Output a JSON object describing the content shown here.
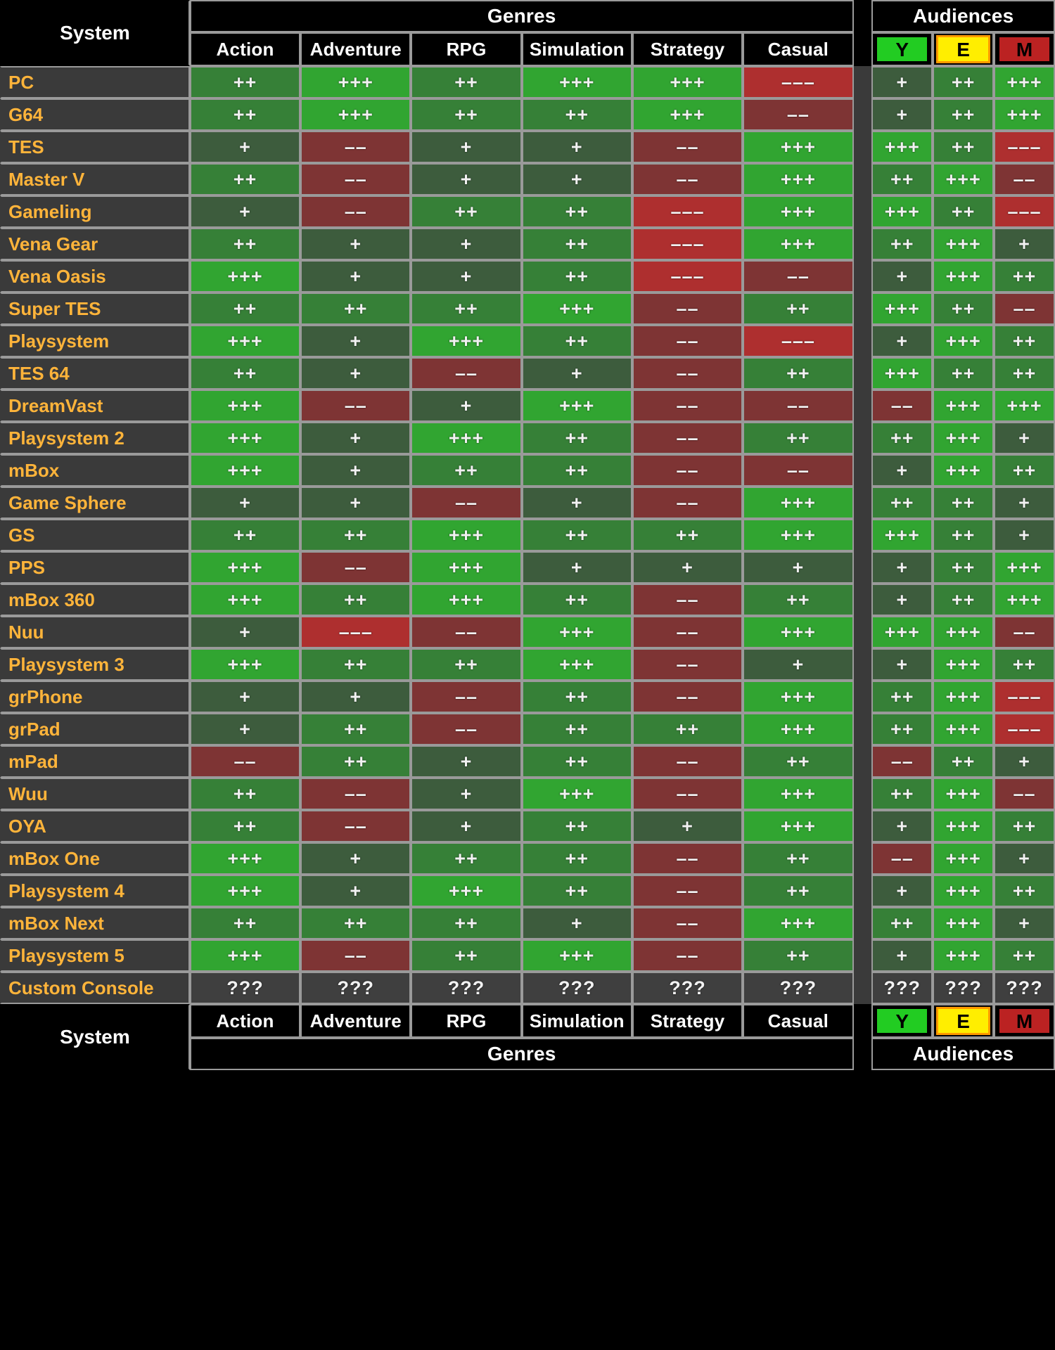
{
  "header": {
    "system_label": "System",
    "genres_group": "Genres",
    "audiences_group": "Audiences",
    "genre_columns": [
      "Action",
      "Adventure",
      "RPG",
      "Simulation",
      "Strategy",
      "Casual"
    ],
    "audience_columns": [
      "Y",
      "E",
      "M"
    ]
  },
  "footer": {
    "system_label": "System",
    "genres_group": "Genres",
    "audiences_group": "Audiences",
    "genre_columns": [
      "Action",
      "Adventure",
      "RPG",
      "Simulation",
      "Strategy",
      "Casual"
    ],
    "audience_columns": [
      "Y",
      "E",
      "M"
    ]
  },
  "colors": {
    "page_background": "#000000",
    "grid_line": "#9a9a9a",
    "system_cell_background": "#3a3a3a",
    "system_name_text": "#ffb43a",
    "rating_text": "#f2f2f2",
    "plus1": "#3d5c3d",
    "plus2": "#368037",
    "plus3": "#31a531",
    "minus1": "#7a3838",
    "minus2": "#7e3434",
    "minus3": "#ae2f2f",
    "unknown": "#3f3f3f",
    "badge_y_background": "#22cc22",
    "badge_e_background": "#ffee00",
    "badge_e_border": "#ff9900",
    "badge_m_background": "#bb2222"
  },
  "legend": {
    "plus_three": "+++",
    "plus_two": "++",
    "plus_one": "+",
    "minus_one": "–",
    "minus_two": "––",
    "minus_three": "–––",
    "unknown": "???"
  },
  "chart_data": {
    "type": "heatmap",
    "title": "",
    "xlabel": "",
    "ylabel": "System",
    "row_key": "System",
    "column_groups": [
      {
        "name": "Genres",
        "columns": [
          "Action",
          "Adventure",
          "RPG",
          "Simulation",
          "Strategy",
          "Casual"
        ]
      },
      {
        "name": "Audiences",
        "columns": [
          "Y",
          "E",
          "M"
        ]
      }
    ],
    "value_scale": [
      "---",
      "--",
      "-",
      "+",
      "++",
      "+++",
      "???"
    ],
    "rows": [
      {
        "name": "PC",
        "genres": [
          "++",
          "+++",
          "++",
          "+++",
          "+++",
          "---"
        ],
        "audiences": [
          "+",
          "++",
          "+++"
        ]
      },
      {
        "name": "G64",
        "genres": [
          "++",
          "+++",
          "++",
          "++",
          "+++",
          "--"
        ],
        "audiences": [
          "+",
          "++",
          "+++"
        ]
      },
      {
        "name": "TES",
        "genres": [
          "+",
          "--",
          "+",
          "+",
          "--",
          "+++"
        ],
        "audiences": [
          "+++",
          "++",
          "---"
        ]
      },
      {
        "name": "Master V",
        "genres": [
          "++",
          "--",
          "+",
          "+",
          "--",
          "+++"
        ],
        "audiences": [
          "++",
          "+++",
          "--"
        ]
      },
      {
        "name": "Gameling",
        "genres": [
          "+",
          "--",
          "++",
          "++",
          "---",
          "+++"
        ],
        "audiences": [
          "+++",
          "++",
          "---"
        ]
      },
      {
        "name": "Vena Gear",
        "genres": [
          "++",
          "+",
          "+",
          "++",
          "---",
          "+++"
        ],
        "audiences": [
          "++",
          "+++",
          "+"
        ]
      },
      {
        "name": "Vena Oasis",
        "genres": [
          "+++",
          "+",
          "+",
          "++",
          "---",
          "--"
        ],
        "audiences": [
          "+",
          "+++",
          "++"
        ]
      },
      {
        "name": "Super TES",
        "genres": [
          "++",
          "++",
          "++",
          "+++",
          "--",
          "++"
        ],
        "audiences": [
          "+++",
          "++",
          "--"
        ]
      },
      {
        "name": "Playsystem",
        "genres": [
          "+++",
          "+",
          "+++",
          "++",
          "--",
          "---"
        ],
        "audiences": [
          "+",
          "+++",
          "++"
        ]
      },
      {
        "name": "TES 64",
        "genres": [
          "++",
          "+",
          "--",
          "+",
          "--",
          "++"
        ],
        "audiences": [
          "+++",
          "++",
          "++"
        ]
      },
      {
        "name": "DreamVast",
        "genres": [
          "+++",
          "--",
          "+",
          "+++",
          "--",
          "--"
        ],
        "audiences": [
          "--",
          "+++",
          "+++"
        ]
      },
      {
        "name": "Playsystem 2",
        "genres": [
          "+++",
          "+",
          "+++",
          "++",
          "--",
          "++"
        ],
        "audiences": [
          "++",
          "+++",
          "+"
        ]
      },
      {
        "name": "mBox",
        "genres": [
          "+++",
          "+",
          "++",
          "++",
          "--",
          "--"
        ],
        "audiences": [
          "+",
          "+++",
          "++"
        ]
      },
      {
        "name": "Game Sphere",
        "genres": [
          "+",
          "+",
          "--",
          "+",
          "--",
          "+++"
        ],
        "audiences": [
          "++",
          "++",
          "+"
        ]
      },
      {
        "name": "GS",
        "genres": [
          "++",
          "++",
          "+++",
          "++",
          "++",
          "+++"
        ],
        "audiences": [
          "+++",
          "++",
          "+"
        ]
      },
      {
        "name": "PPS",
        "genres": [
          "+++",
          "--",
          "+++",
          "+",
          "+",
          "+"
        ],
        "audiences": [
          "+",
          "++",
          "+++"
        ]
      },
      {
        "name": "mBox 360",
        "genres": [
          "+++",
          "++",
          "+++",
          "++",
          "--",
          "++"
        ],
        "audiences": [
          "+",
          "++",
          "+++"
        ]
      },
      {
        "name": "Nuu",
        "genres": [
          "+",
          "---",
          "--",
          "+++",
          "--",
          "+++"
        ],
        "audiences": [
          "+++",
          "+++",
          "--"
        ]
      },
      {
        "name": "Playsystem 3",
        "genres": [
          "+++",
          "++",
          "++",
          "+++",
          "--",
          "+"
        ],
        "audiences": [
          "+",
          "+++",
          "++"
        ]
      },
      {
        "name": "grPhone",
        "genres": [
          "+",
          "+",
          "--",
          "++",
          "--",
          "+++"
        ],
        "audiences": [
          "++",
          "+++",
          "---"
        ]
      },
      {
        "name": "grPad",
        "genres": [
          "+",
          "++",
          "--",
          "++",
          "++",
          "+++"
        ],
        "audiences": [
          "++",
          "+++",
          "---"
        ]
      },
      {
        "name": "mPad",
        "genres": [
          "--",
          "++",
          "+",
          "++",
          "--",
          "++"
        ],
        "audiences": [
          "--",
          "++",
          "+"
        ]
      },
      {
        "name": "Wuu",
        "genres": [
          "++",
          "--",
          "+",
          "+++",
          "--",
          "+++"
        ],
        "audiences": [
          "++",
          "+++",
          "--"
        ]
      },
      {
        "name": "OYA",
        "genres": [
          "++",
          "--",
          "+",
          "++",
          "+",
          "+++"
        ],
        "audiences": [
          "+",
          "+++",
          "++"
        ]
      },
      {
        "name": "mBox One",
        "genres": [
          "+++",
          "+",
          "++",
          "++",
          "--",
          "++"
        ],
        "audiences": [
          "--",
          "+++",
          "+"
        ]
      },
      {
        "name": "Playsystem 4",
        "genres": [
          "+++",
          "+",
          "+++",
          "++",
          "--",
          "++"
        ],
        "audiences": [
          "+",
          "+++",
          "++"
        ]
      },
      {
        "name": "mBox Next",
        "genres": [
          "++",
          "++",
          "++",
          "+",
          "--",
          "+++"
        ],
        "audiences": [
          "++",
          "+++",
          "+"
        ]
      },
      {
        "name": "Playsystem 5",
        "genres": [
          "+++",
          "--",
          "++",
          "+++",
          "--",
          "++"
        ],
        "audiences": [
          "+",
          "+++",
          "++"
        ]
      },
      {
        "name": "Custom Console",
        "genres": [
          "???",
          "???",
          "???",
          "???",
          "???",
          "???"
        ],
        "audiences": [
          "???",
          "???",
          "???"
        ]
      }
    ]
  }
}
